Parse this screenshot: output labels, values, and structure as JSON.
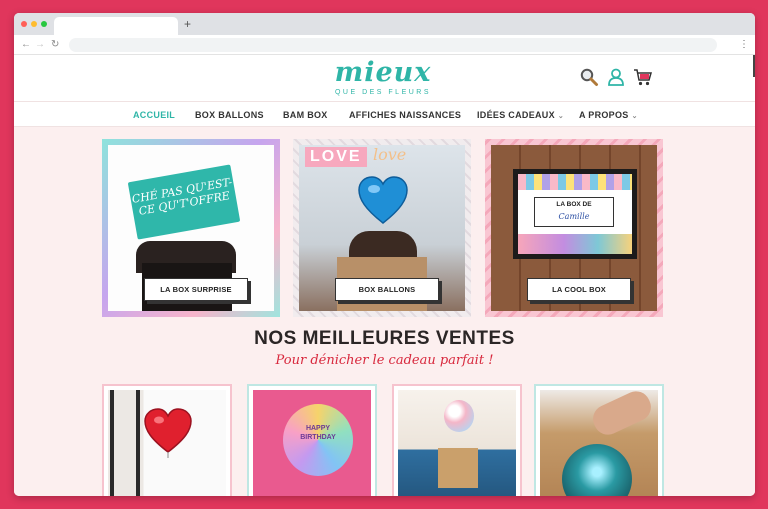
{
  "header": {
    "logo_main": "mieux",
    "logo_sub": "QUE DES FLEURS",
    "icons": [
      "search-icon",
      "account-icon",
      "cart-icon"
    ]
  },
  "browser": {
    "new_tab_glyph": "+"
  },
  "nav": {
    "items": [
      {
        "label": "ACCUEIL",
        "active": true
      },
      {
        "label": "BOX BALLONS",
        "active": false
      },
      {
        "label": "BAM BOX",
        "active": false
      },
      {
        "label": "AFFICHES NAISSANCES",
        "active": false
      },
      {
        "label": "IDÉES CADEAUX",
        "active": false,
        "dropdown": true
      },
      {
        "label": "A PROPOS",
        "active": false,
        "dropdown": true
      }
    ]
  },
  "promos": [
    {
      "button": "LA BOX SURPRISE",
      "sign_text": "CHÉ PAS QU'EST-CE QU'T'OFFRE"
    },
    {
      "button": "BOX BALLONS",
      "overlay_word": "LOVE",
      "overlay_script": "love"
    },
    {
      "button": "LA COOL BOX",
      "box_label": "LA BOX DE",
      "box_name": "Camille"
    }
  ],
  "bestsellers": {
    "title": "NOS MEILLEURES VENTES",
    "subtitle": "Pour dénicher le cadeau parfait !",
    "balloon_text": "HAPPY BIRTHDAY"
  },
  "colors": {
    "frame": "#e0365c",
    "brand": "#2fb5a7",
    "content_bg": "#fcefef",
    "accent_red": "#d8283d"
  }
}
